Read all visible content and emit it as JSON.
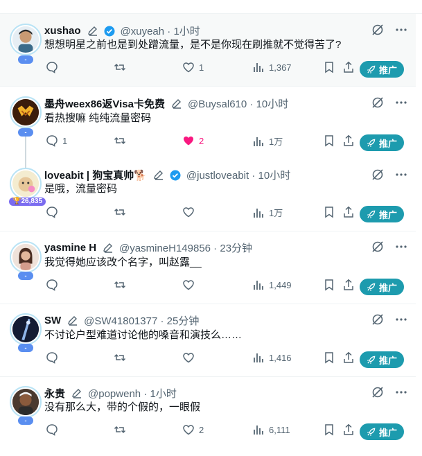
{
  "action_promote_label": "推广",
  "tweets": [
    {
      "name": "xushao",
      "handle": "@xuyeah",
      "time": "1小时",
      "verified": true,
      "text": "想想明星之前也是到处蹭流量，是不是你现在刷推就不觉得苦了?",
      "reply": "",
      "retweet": "",
      "like": "1",
      "views": "1,367",
      "pill": "-",
      "highlight": true
    },
    {
      "name": "墨舟weex86返Visa卡免费",
      "handle": "@Buysal610",
      "time": "10小时",
      "verified": false,
      "text": "看热搜嘛 纯纯流量密码",
      "reply": "1",
      "retweet": "",
      "like": "2",
      "views": "1万",
      "pill": "-",
      "liked": true
    },
    {
      "name": "loveabit | 狗宝真帅🐕",
      "handle": "@justloveabit",
      "time": "10小时",
      "verified": true,
      "text": "是哦，流量密码",
      "reply": "",
      "retweet": "",
      "like": "",
      "views": "1万",
      "pill": "🏆26,835"
    },
    {
      "name": "yasmine H",
      "handle": "@yasmineH149856",
      "time": "23分钟",
      "verified": false,
      "text": "我觉得她应该改个名字，叫赵露__",
      "reply": "",
      "retweet": "",
      "like": "",
      "views": "1,449",
      "pill": "-"
    },
    {
      "name": "SW",
      "handle": "@SW41801377",
      "time": "25分钟",
      "verified": false,
      "text": "不讨论户型难道讨论他的嗓音和演技么……",
      "reply": "",
      "retweet": "",
      "like": "",
      "views": "1,416",
      "pill": "-"
    },
    {
      "name": "永贵",
      "handle": "@popwenh",
      "time": "1小时",
      "verified": false,
      "text": "没有那么大，带的个假的，一眼假",
      "reply": "",
      "retweet": "",
      "like": "2",
      "views": "6,111",
      "pill": "-"
    }
  ]
}
